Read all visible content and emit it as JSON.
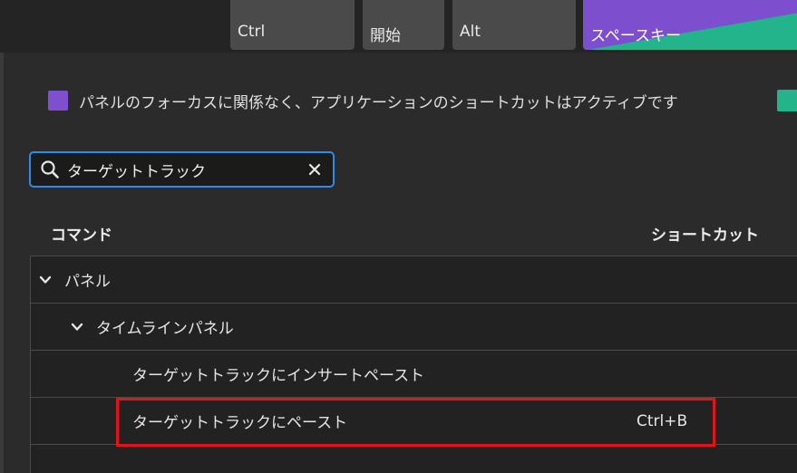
{
  "keyboard": {
    "keys": [
      {
        "label": "Ctrl"
      },
      {
        "label": "開始"
      },
      {
        "label": "Alt"
      },
      {
        "label": "スペースキー"
      }
    ]
  },
  "legend": {
    "text": "パネルのフォーカスに関係なく、アプリケーションのショートカットはアクティブです",
    "swatch_color": "#7e4fcf",
    "secondary_swatch_color": "#23b48c"
  },
  "search": {
    "value": "ターゲットトラック",
    "icon": "search-icon",
    "clear_icon": "close-icon"
  },
  "columns": {
    "command": "コマンド",
    "shortcut": "ショートカット"
  },
  "tree": {
    "rows": [
      {
        "label": "パネル",
        "level": 0,
        "expanded": true,
        "shortcut": ""
      },
      {
        "label": "タイムラインパネル",
        "level": 1,
        "expanded": true,
        "shortcut": ""
      },
      {
        "label": "ターゲットトラックにインサートペースト",
        "level": 2,
        "shortcut": ""
      },
      {
        "label": "ターゲットトラックにペースト",
        "level": 2,
        "shortcut": "Ctrl+B",
        "highlighted": true
      }
    ]
  },
  "colors": {
    "accent_blue": "#2d8ceb",
    "highlight_red": "#e0151b",
    "purple": "#7e4fcf",
    "green": "#23b48c"
  }
}
